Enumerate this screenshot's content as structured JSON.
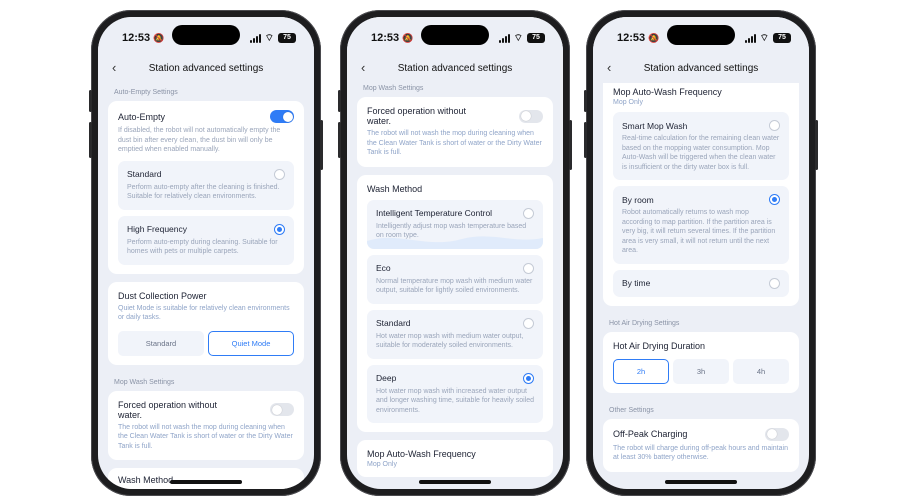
{
  "status": {
    "time": "12:53",
    "battery": "75"
  },
  "nav": {
    "title": "Station advanced settings"
  },
  "screen1": {
    "auto_empty_section": "Auto-Empty Settings",
    "auto_empty": {
      "title": "Auto-Empty",
      "desc": "If disabled, the robot will not automatically empty the dust bin after every clean, the dust bin will only be emptied when enabled manually.",
      "enabled": true,
      "options": [
        {
          "title": "Standard",
          "desc": "Perform auto-empty after the cleaning is finished. Suitable for relatively clean environments.",
          "selected": false
        },
        {
          "title": "High Frequency",
          "desc": "Perform auto-empty during cleaning. Suitable for homes with pets or multiple carpets.",
          "selected": true
        }
      ]
    },
    "dust_power": {
      "title": "Dust Collection Power",
      "desc": "Quiet Mode is suitable for relatively clean environments or daily tasks.",
      "options": [
        "Standard",
        "Quiet Mode"
      ],
      "selected": "Quiet Mode"
    },
    "mop_wash_section": "Mop Wash Settings",
    "forced": {
      "title": "Forced operation without water.",
      "desc": "The robot will not wash the mop during cleaning when the Clean Water Tank is short of water or the Dirty Water Tank is full.",
      "enabled": false
    },
    "wash_method_title": "Wash Method"
  },
  "screen2": {
    "mop_wash_section": "Mop Wash Settings",
    "forced": {
      "title": "Forced operation without water.",
      "desc": "The robot will not wash the mop during cleaning when the Clean Water Tank is short of water or the Dirty Water Tank is full.",
      "enabled": false
    },
    "wash_method": {
      "title": "Wash Method",
      "options": [
        {
          "title": "Intelligent Temperature Control",
          "desc": "Intelligently adjust mop wash temperature based on room type.",
          "selected": false
        },
        {
          "title": "Eco",
          "desc": "Normal temperature mop wash with medium water output, suitable for lightly soiled environments.",
          "selected": false
        },
        {
          "title": "Standard",
          "desc": "Hot water mop wash with medium water output, suitable for moderately soiled environments.",
          "selected": false
        },
        {
          "title": "Deep",
          "desc": "Hot water mop wash with increased water output and longer washing time, suitable for heavily soiled environments.",
          "selected": true
        }
      ]
    },
    "auto_wash_freq": {
      "title": "Mop Auto-Wash Frequency",
      "sub": "Mop Only"
    }
  },
  "screen3": {
    "auto_wash_freq": {
      "title": "Mop Auto-Wash Frequency",
      "sub": "Mop Only",
      "options": [
        {
          "title": "Smart Mop Wash",
          "desc": "Real-time calculation for the remaining clean water based on the mopping water consumption. Mop Auto-Wash will be triggered when the clean water is insufficient or the dirty water box is full.",
          "selected": false
        },
        {
          "title": "By room",
          "desc": "Robot automatically returns to wash mop according to map partition. If the partition area is very big, it will return several times. If the partition area is very small, it will not return until the next area.",
          "selected": true
        },
        {
          "title": "By time",
          "desc": "",
          "selected": false
        }
      ]
    },
    "hot_air_section": "Hot Air Drying Settings",
    "hot_air": {
      "title": "Hot Air Drying Duration",
      "options": [
        "2h",
        "3h",
        "4h"
      ],
      "selected": "2h"
    },
    "other_section": "Other Settings",
    "off_peak": {
      "title": "Off-Peak Charging",
      "desc": "The robot will charge during off-peak hours and maintain at least 30% battery otherwise.",
      "enabled": false
    }
  },
  "colors": {
    "accent": "#2f7cf6",
    "background": "#eceff6",
    "card": "#ffffff",
    "muted_text": "#9aa5ba"
  },
  "icons": {
    "back": "chevron-left-icon",
    "bell": "bell-slash-icon",
    "signal": "signal-icon",
    "wifi": "wifi-icon",
    "battery": "battery-icon"
  }
}
